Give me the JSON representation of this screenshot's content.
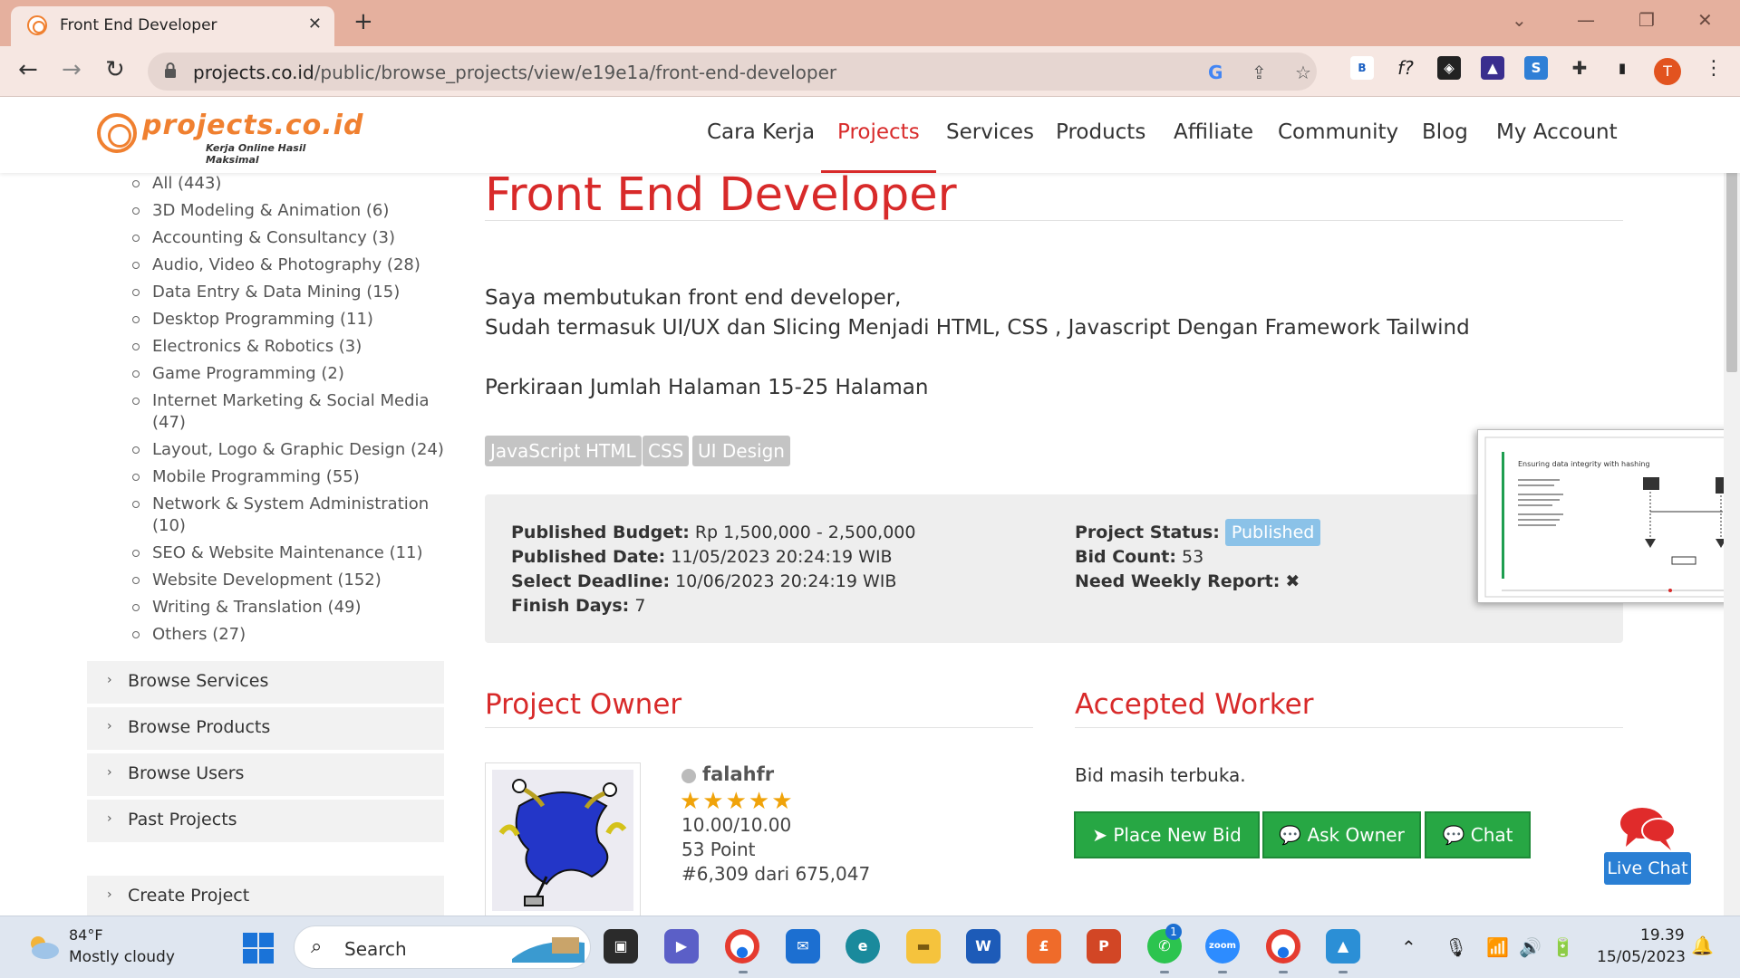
{
  "browser": {
    "tab_title": "Front End Developer",
    "url_host": "projects.co.id",
    "url_path": "/public/browse_projects/view/e19e1a/front-end-developer",
    "profile_initial": "T"
  },
  "site": {
    "logo_text": "projects.co.id",
    "logo_tagline": "Kerja Online Hasil Maksimal",
    "nav": [
      "Cara Kerja",
      "Projects",
      "Services",
      "Products",
      "Affiliate",
      "Community",
      "Blog",
      "My Account"
    ],
    "active_nav": "Projects"
  },
  "sidebar": {
    "categories": [
      {
        "label": "All (443)"
      },
      {
        "label": "3D Modeling & Animation (6)"
      },
      {
        "label": "Accounting & Consultancy (3)"
      },
      {
        "label": "Audio, Video & Photography (28)"
      },
      {
        "label": "Data Entry & Data Mining (15)"
      },
      {
        "label": "Desktop Programming (11)"
      },
      {
        "label": "Electronics & Robotics (3)"
      },
      {
        "label": "Game Programming (2)"
      },
      {
        "label": "Internet Marketing & Social Media",
        "label2": "(47)"
      },
      {
        "label": "Layout, Logo & Graphic Design (24)"
      },
      {
        "label": "Mobile Programming (55)"
      },
      {
        "label": "Network & System Administration",
        "label2": "(10)"
      },
      {
        "label": "SEO & Website Maintenance (11)"
      },
      {
        "label": "Website Development (152)"
      },
      {
        "label": "Writing & Translation (49)"
      },
      {
        "label": "Others (27)"
      }
    ],
    "links": [
      "Browse Services",
      "Browse Products",
      "Browse Users",
      "Past Projects",
      "Create Project"
    ]
  },
  "project": {
    "title": "Front End Developer",
    "description": [
      "Saya membutukan front end developer,",
      "Sudah termasuk UI/UX dan Slicing Menjadi HTML, CSS , Javascript Dengan Framework Tailwind",
      "Perkiraan Jumlah Halaman 15-25 Halaman"
    ],
    "tags": [
      "JavaScript",
      "HTML",
      "CSS",
      "UI Design"
    ],
    "info_left": [
      {
        "label": "Published Budget:",
        "value": "Rp 1,500,000 - 2,500,000"
      },
      {
        "label": "Published Date:",
        "value": "11/05/2023 20:24:19 WIB"
      },
      {
        "label": "Select Deadline:",
        "value": "10/06/2023 20:24:19 WIB"
      },
      {
        "label": "Finish Days:",
        "value": "7"
      }
    ],
    "status_label": "Project Status:",
    "status_value": "Published",
    "bid_count_label": "Bid Count:",
    "bid_count_value": "53",
    "weekly_report_label": "Need Weekly Report:",
    "weekly_report_value": "✖"
  },
  "owner": {
    "heading": "Project Owner",
    "username": "falahfr",
    "rating_stars": 5,
    "rating": "10.00/10.00",
    "points": "53 Point",
    "rank": "#6,309 dari 675,047"
  },
  "worker": {
    "heading": "Accepted Worker",
    "status": "Bid masih terbuka.",
    "buttons": [
      "Place New Bid",
      "Ask Owner",
      "Chat"
    ]
  },
  "popup": {
    "slide_title": "Ensuring data integrity with hashing"
  },
  "livechat": {
    "label": "Live Chat"
  },
  "taskbar": {
    "weather_temp": "84°F",
    "weather_desc": "Mostly cloudy",
    "search_placeholder": "Search",
    "time": "19.39",
    "date": "15/05/2023",
    "whatsapp_badge": "1"
  },
  "colors": {
    "accent_red": "#d82a2a",
    "button_green": "#27a744",
    "status_blue": "#8bc2e8",
    "tag_grey": "#c4c4c4",
    "tabbar": "#e5b09e"
  }
}
